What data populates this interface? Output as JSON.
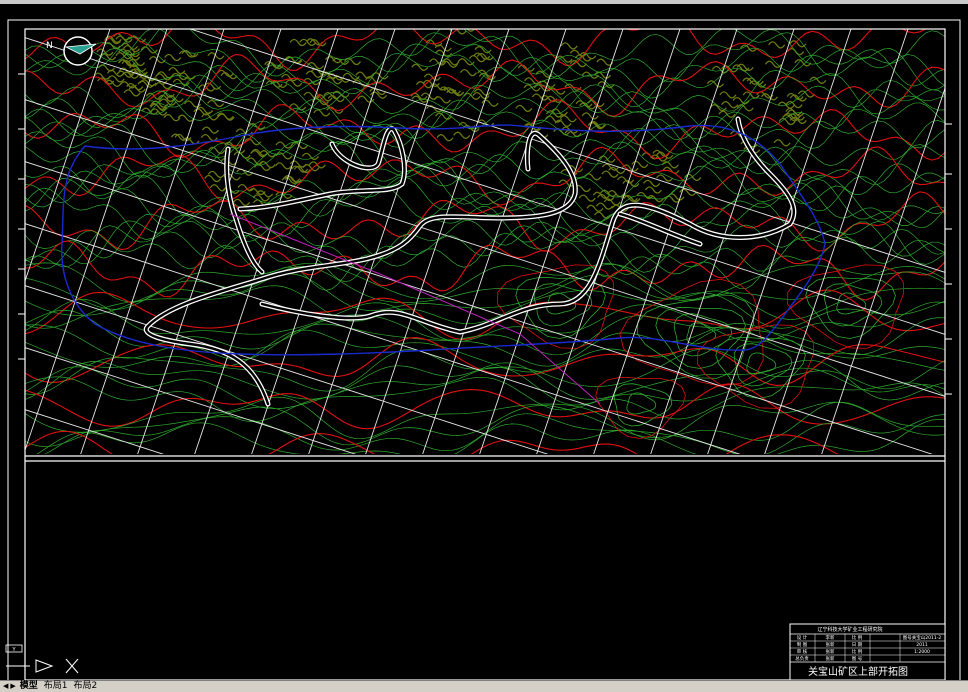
{
  "drawing": {
    "north_label": "N",
    "title": "关宝山矿区上部开拓图",
    "title_block": {
      "company": "辽宁科技大学矿业工程研究院",
      "rows": [
        [
          "设  计",
          "李新",
          "比  例",
          "图号关宝山2011-2"
        ],
        [
          "制  图",
          "张新",
          "日  期",
          "2011"
        ],
        [
          "审  核",
          "张新",
          "比  例",
          "1:2000"
        ],
        [
          "总负责",
          "张新",
          "图  号",
          ""
        ]
      ]
    }
  },
  "ucs_icon": {
    "x_label": "X",
    "y_label": "Y"
  },
  "status": {
    "tabs": [
      "模型",
      "布局1",
      "布局2"
    ],
    "active_tab": "模型"
  },
  "colors": {
    "background": "#000000",
    "contour_green": "#2ea82e",
    "contour_red": "#e01010",
    "contour_olive": "#6b7a10",
    "boundary_blue": "#1a2ad0",
    "road_white": "#ffffff",
    "grid_white": "#e8e8e8",
    "magenta": "#c020c0"
  }
}
